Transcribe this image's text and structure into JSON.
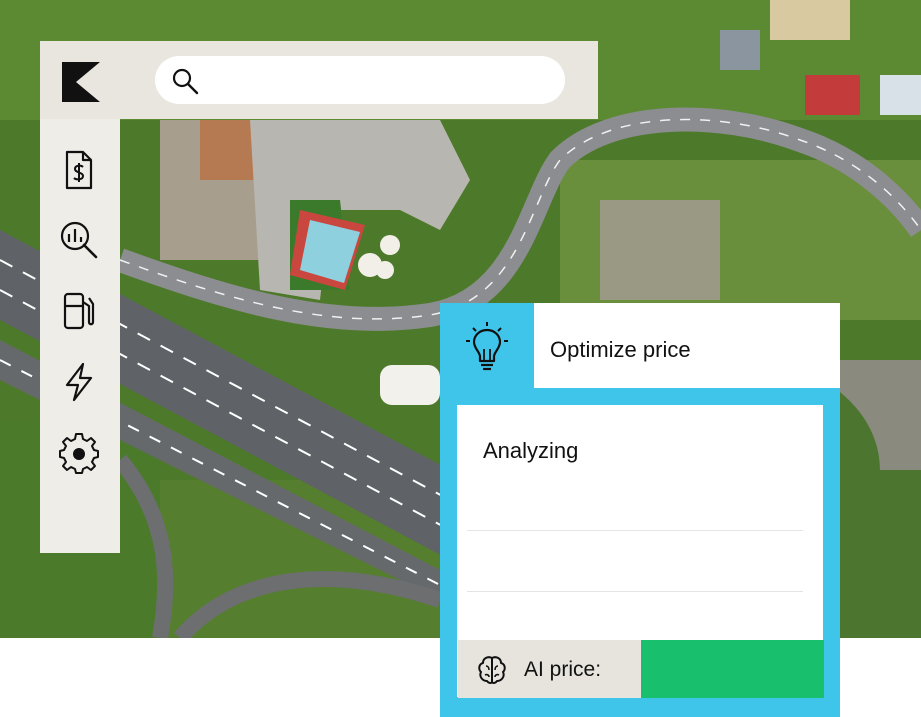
{
  "search": {
    "placeholder": "",
    "value": ""
  },
  "sidebar": {
    "items": [
      {
        "name": "pricing",
        "icon": "dollar-document-icon"
      },
      {
        "name": "analytics",
        "icon": "chart-search-icon"
      },
      {
        "name": "fuel",
        "icon": "fuel-pump-icon"
      },
      {
        "name": "energy",
        "icon": "lightning-icon"
      },
      {
        "name": "settings",
        "icon": "gear-icon"
      }
    ]
  },
  "panel": {
    "title": "Optimize price",
    "status": "Analyzing",
    "ai_label": "AI price:",
    "ai_value": ""
  },
  "colors": {
    "accent": "#3fc5ea",
    "ai_value": "#18c06e",
    "topbar": "#e9e6df",
    "sidebar": "#efede8"
  }
}
